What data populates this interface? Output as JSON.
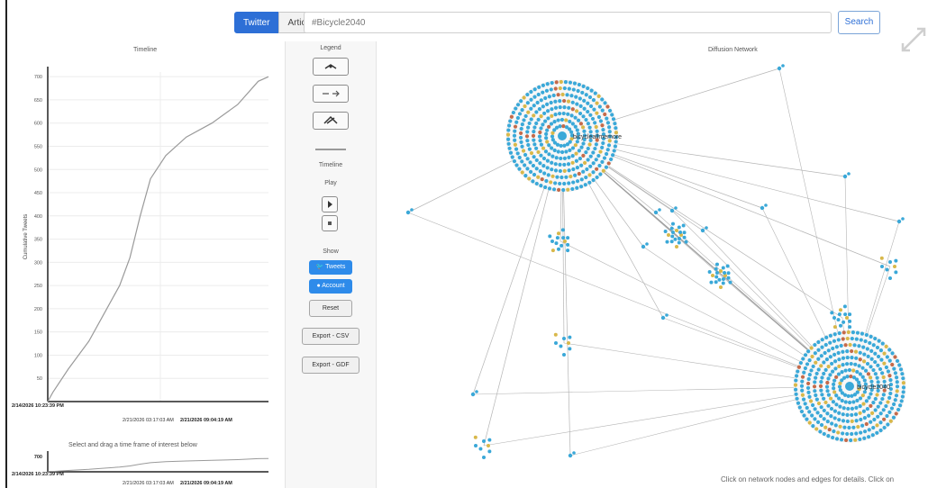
{
  "topbar": {
    "tabs": [
      {
        "label": "Twitter",
        "active": true
      },
      {
        "label": "Articles",
        "active": false
      }
    ],
    "query_value": "#Bicycle2040",
    "search_label": "Search"
  },
  "timeline": {
    "title": "Timeline",
    "brush_label": "Select and drag a time frame of interest below",
    "footer_date": "2/14/2026 10:23:39 PM"
  },
  "chart_data": {
    "type": "line",
    "title": "Timeline",
    "ylabel": "Cumulative Tweets",
    "ylim": [
      0,
      710
    ],
    "y_ticks": [
      "50",
      "100",
      "150",
      "200",
      "250",
      "300",
      "350",
      "400",
      "450",
      "500",
      "550",
      "600",
      "650",
      "700"
    ],
    "x": [
      0,
      5,
      20,
      40,
      55,
      70,
      80,
      90,
      100,
      115,
      135,
      160,
      185,
      205,
      215
    ],
    "y": [
      0,
      20,
      70,
      130,
      190,
      250,
      310,
      400,
      480,
      530,
      570,
      600,
      640,
      690,
      700
    ],
    "x_start_label": "2/14/2026 10:23:39 PM",
    "x_mid_label": "2/21/2026 03:17:03 AM",
    "x_end_label": "2/21/2026 09:04:19 AM",
    "brush_ylabel": "700"
  },
  "controls": {
    "legend_title": "Legend",
    "legend_buttons": [
      "Tweet icons",
      "Retweets",
      "Quotes"
    ],
    "timeline_label": "Timeline",
    "play_label": "Play",
    "show_label": "Show",
    "tweets_label": "Tweets",
    "accounts_label": "Account",
    "reset_label": "Reset",
    "export_csv": "Export - CSV",
    "export_gdf": "Export - GDF"
  },
  "network": {
    "title": "Diffusion Network",
    "hub_a_label": "bicycleallmemore",
    "hub_b_label": "bicycle2040",
    "footer": "Click on network nodes and edges for details. Click on"
  },
  "colors": {
    "accent": "#2d6fd6",
    "node": "#3aa8d8",
    "line": "#b5b5b5"
  }
}
